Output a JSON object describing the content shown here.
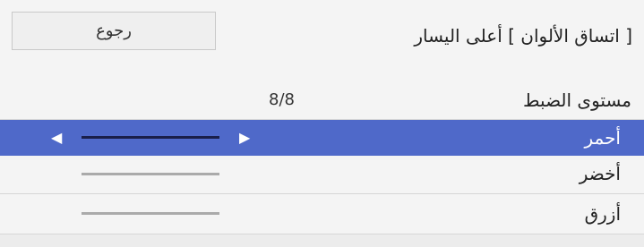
{
  "header": {
    "back_label": "رجوع",
    "title": "[ اتساق الألوان ] أعلى اليسار"
  },
  "level": {
    "label": "مستوى الضبط",
    "value": "8/8"
  },
  "colors": [
    {
      "label": "أحمر",
      "selected": true
    },
    {
      "label": "أخضر",
      "selected": false
    },
    {
      "label": "أزرق",
      "selected": false
    }
  ],
  "arrows": {
    "left": "◀",
    "right": "▶"
  },
  "style": {
    "accent": "#4f69c9",
    "slider_selected": "#1a1f4a",
    "slider_default": "#aaaaaa"
  }
}
